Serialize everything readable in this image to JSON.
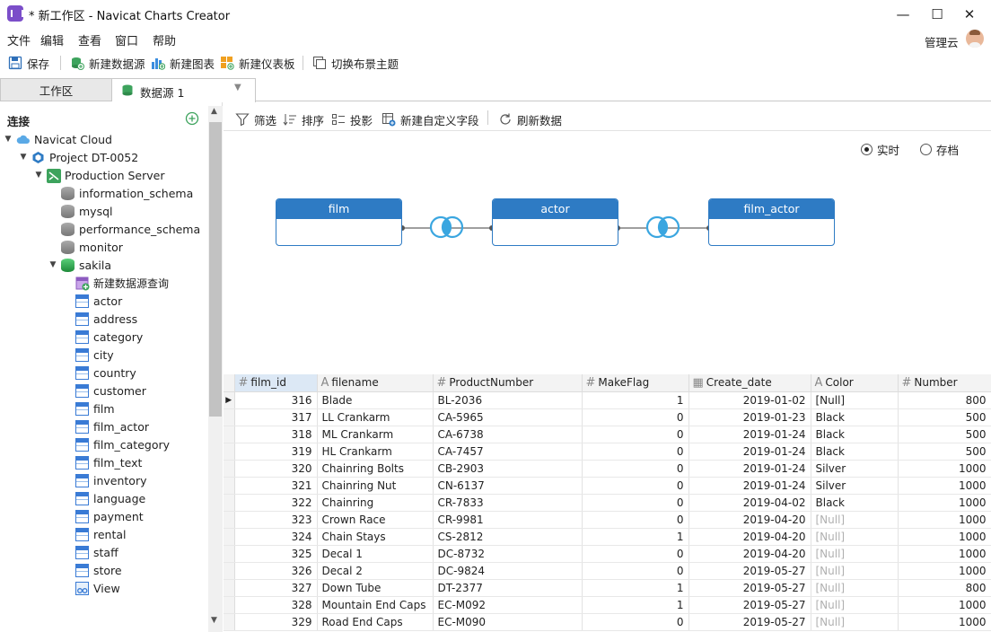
{
  "window": {
    "title": "* 新工作区 - Navicat Charts Creator",
    "minimize": "—",
    "maximize": "☐",
    "close": "✕"
  },
  "menu": [
    "文件",
    "编辑",
    "查看",
    "窗口",
    "帮助"
  ],
  "user": {
    "name": "管理云"
  },
  "toolbar": {
    "save": "保存",
    "new_datasource": "新建数据源",
    "new_chart": "新建图表",
    "new_dashboard": "新建仪表板",
    "switch_theme": "切换布景主题"
  },
  "tabs": {
    "workspace": "工作区",
    "datasource": "数据源 1"
  },
  "sidebar": {
    "title": "连接",
    "cloud": "Navicat Cloud",
    "project": "Project DT-0052",
    "server": "Production Server",
    "databases": [
      "information_schema",
      "mysql",
      "performance_schema",
      "monitor"
    ],
    "sakila": "sakila",
    "new_query": "新建数据源查询",
    "tables": [
      "actor",
      "address",
      "category",
      "city",
      "country",
      "customer",
      "film",
      "film_actor",
      "film_category",
      "film_text",
      "inventory",
      "language",
      "payment",
      "rental",
      "staff",
      "store"
    ],
    "view": "View"
  },
  "main_toolbar": {
    "filter": "筛选",
    "sort": "排序",
    "project": "投影",
    "new_field": "新建自定义字段",
    "refresh": "刷新数据"
  },
  "mode": {
    "realtime": "实时",
    "archive": "存档",
    "selected": "realtime"
  },
  "diagram": {
    "tables": [
      "film",
      "actor",
      "film_actor"
    ]
  },
  "grid": {
    "columns": [
      "film_id",
      "filename",
      "ProductNumber",
      "MakeFlag",
      "Create_date",
      "Color",
      "Number"
    ],
    "column_types": [
      "number",
      "text",
      "number",
      "number",
      "date",
      "text",
      "number"
    ],
    "rows": [
      [
        "316",
        "Blade",
        "BL-2036",
        "1",
        "2019-01-02",
        "[Null]",
        "800"
      ],
      [
        "317",
        "LL Crankarm",
        "CA-5965",
        "0",
        "2019-01-23",
        "Black",
        "500"
      ],
      [
        "318",
        "ML Crankarm",
        "CA-6738",
        "0",
        "2019-01-24",
        "Black",
        "500"
      ],
      [
        "319",
        "HL Crankarm",
        "CA-7457",
        "0",
        "2019-01-24",
        "Black",
        "500"
      ],
      [
        "320",
        "Chainring Bolts",
        "CB-2903",
        "0",
        "2019-01-24",
        "Silver",
        "1000"
      ],
      [
        "321",
        "Chainring Nut",
        "CN-6137",
        "0",
        "2019-01-24",
        "Silver",
        "1000"
      ],
      [
        "322",
        "Chainring",
        "CR-7833",
        "0",
        "2019-04-02",
        "Black",
        "1000"
      ],
      [
        "323",
        "Crown Race",
        "CR-9981",
        "0",
        "2019-04-20",
        "[Null]",
        "1000"
      ],
      [
        "324",
        "Chain Stays",
        "CS-2812",
        "1",
        "2019-04-20",
        "[Null]",
        "1000"
      ],
      [
        "325",
        "Decal 1",
        "DC-8732",
        "0",
        "2019-04-20",
        "[Null]",
        "1000"
      ],
      [
        "326",
        "Decal 2",
        "DC-9824",
        "0",
        "2019-05-27",
        "[Null]",
        "1000"
      ],
      [
        "327",
        "Down Tube",
        "DT-2377",
        "1",
        "2019-05-27",
        "[Null]",
        "800"
      ],
      [
        "328",
        "Mountain End Caps",
        "EC-M092",
        "1",
        "2019-05-27",
        "[Null]",
        "1000"
      ],
      [
        "329",
        "Road End Caps",
        "EC-M090",
        "0",
        "2019-05-27",
        "[Null]",
        "1000"
      ]
    ]
  }
}
